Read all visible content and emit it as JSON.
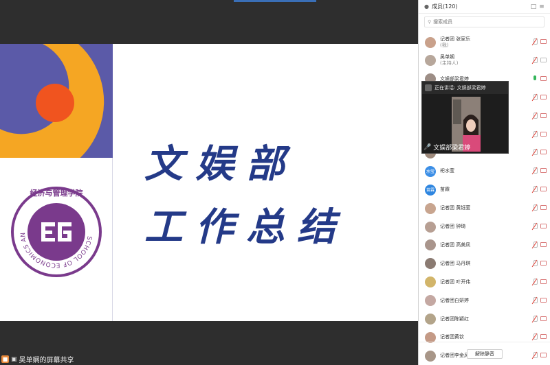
{
  "stage": {
    "share_label": "吴单娴的屏幕共享"
  },
  "slide": {
    "title_line1": "文娱部",
    "title_line2": "工作总结",
    "logo_chars": "经济与管理学院",
    "logo_english": "SCHOOL OF ECONOMICS AND MANAGEMENT",
    "colors": {
      "title": "#243a88",
      "deco_purple": "#5b5aa8",
      "deco_orange": "#f5a623",
      "deco_red": "#f0541f",
      "logo_purple": "#7a3a8c"
    }
  },
  "panel": {
    "title": "成员(120)",
    "search_placeholder": "搜索成员",
    "unmute_all_label": "解除静音"
  },
  "video": {
    "speaking_label": "正在讲话: 文娱部梁君婷",
    "name_label": "文娱部梁君婷"
  },
  "members": [
    {
      "name": "记者团 张家乐",
      "sub": "(我)",
      "avatar_color": "#c9a18b",
      "avatar_text": "",
      "mic": "off",
      "cam": "off"
    },
    {
      "name": "吴单娴",
      "sub": "(主持人)",
      "avatar_color": "#b7a79b",
      "avatar_text": "",
      "mic": "off",
      "cam": "gray"
    },
    {
      "name": "文娱部梁君婷",
      "sub": "",
      "avatar_color": "#9d8e86",
      "avatar_text": "",
      "mic": "on",
      "cam": "off"
    },
    {
      "name": "",
      "sub": "",
      "avatar_color": "#8a8aa0",
      "avatar_text": "",
      "mic": "off",
      "cam": "off"
    },
    {
      "name": "",
      "sub": "",
      "avatar_color": "#a38f80",
      "avatar_text": "",
      "mic": "off",
      "cam": "off"
    },
    {
      "name": "",
      "sub": "",
      "avatar_color": "#b09a8a",
      "avatar_text": "",
      "mic": "off",
      "cam": "off"
    },
    {
      "name": "",
      "sub": "",
      "avatar_color": "#9e8a7c",
      "avatar_text": "",
      "mic": "off",
      "cam": "off"
    },
    {
      "name": "祀水莹",
      "sub": "",
      "avatar_color": "#3b8ee6",
      "avatar_text": "水莹",
      "mic": "off",
      "cam": "off"
    },
    {
      "name": "苗霖",
      "sub": "",
      "avatar_color": "#2f86e0",
      "avatar_text": "苗霖",
      "mic": "off",
      "cam": "off"
    },
    {
      "name": "记者团 黄钰莹",
      "sub": "",
      "avatar_color": "#c8a58f",
      "avatar_text": "",
      "mic": "off",
      "cam": "off"
    },
    {
      "name": "记者团 钟琦",
      "sub": "",
      "avatar_color": "#b79f93",
      "avatar_text": "",
      "mic": "off",
      "cam": "off"
    },
    {
      "name": "记者团 高美凤",
      "sub": "",
      "avatar_color": "#a9958c",
      "avatar_text": "",
      "mic": "off",
      "cam": "off"
    },
    {
      "name": "记者团 马丹琪",
      "sub": "",
      "avatar_color": "#8b7b72",
      "avatar_text": "",
      "mic": "off",
      "cam": "off"
    },
    {
      "name": "记者团 叶开伟",
      "sub": "",
      "avatar_color": "#d2b56a",
      "avatar_text": "",
      "mic": "off",
      "cam": "off"
    },
    {
      "name": "记者团白妍婷",
      "sub": "",
      "avatar_color": "#c4a8a2",
      "avatar_text": "",
      "mic": "off",
      "cam": "off"
    },
    {
      "name": "记者团陈颖红",
      "sub": "",
      "avatar_color": "#b3a48a",
      "avatar_text": "",
      "mic": "off",
      "cam": "off"
    },
    {
      "name": "记者团黄钦",
      "sub": "",
      "avatar_color": "#c49a86",
      "avatar_text": "",
      "mic": "off",
      "cam": "off"
    },
    {
      "name": "记者团李金凤",
      "sub": "",
      "avatar_color": "#a89688",
      "avatar_text": "",
      "mic": "off",
      "cam": "off"
    }
  ]
}
